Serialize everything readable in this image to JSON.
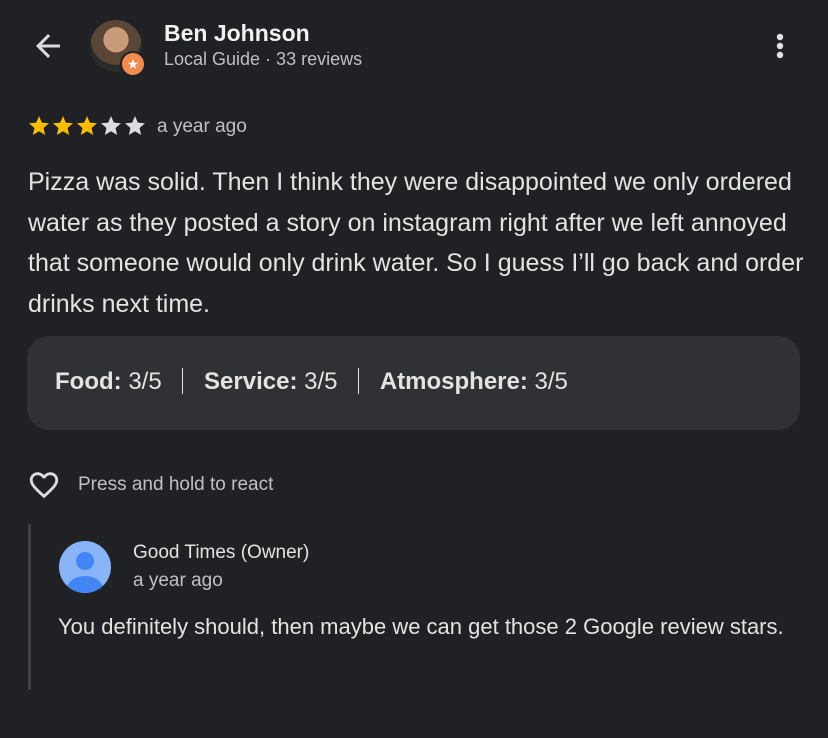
{
  "header": {
    "user_name": "Ben Johnson",
    "user_meta": "Local Guide · 33 reviews",
    "icons": {
      "back": "arrow-left-icon",
      "more": "more-vert-icon",
      "badge": "local-guide-badge-icon"
    }
  },
  "review": {
    "rating": 3,
    "max_rating": 5,
    "date": "a year ago",
    "text": "Pizza was solid. Then I think they were disappointed we only ordered water as they posted a story on instagram right after we left annoyed that someone would only drink water. So I guess I’ll go back and order drinks next time."
  },
  "ratings": {
    "food_label": "Food:",
    "food_value": "3/5",
    "service_label": "Service:",
    "service_value": "3/5",
    "atmosphere_label": "Atmosphere:",
    "atmosphere_value": "3/5"
  },
  "react": {
    "label": "Press and hold to react",
    "icon": "heart-outline-icon"
  },
  "reply": {
    "owner_name": "Good Times (Owner)",
    "date": "a year ago",
    "text": "You definitely should, then maybe we can get those 2 Google review stars."
  },
  "colors": {
    "background": "#202124",
    "card": "#303134",
    "star_filled": "#fbbc04",
    "star_empty": "#dadce0",
    "badge": "#f28b50",
    "owner_avatar": "#8ab4f8"
  }
}
